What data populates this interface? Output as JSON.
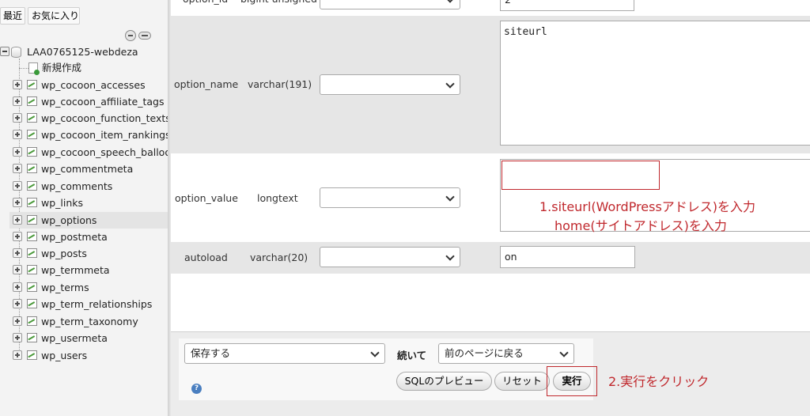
{
  "nav": {
    "tabs": {
      "recent": "最近",
      "favorites": "お気に入り"
    },
    "database": "LAA0765125-webdeza",
    "new_item": "新規作成",
    "tables": [
      "wp_cocoon_accesses",
      "wp_cocoon_affiliate_tags",
      "wp_cocoon_function_texts",
      "wp_cocoon_item_rankings",
      "wp_cocoon_speech_balloons",
      "wp_commentmeta",
      "wp_comments",
      "wp_links",
      "wp_options",
      "wp_postmeta",
      "wp_posts",
      "wp_termmeta",
      "wp_terms",
      "wp_term_relationships",
      "wp_term_taxonomy",
      "wp_usermeta",
      "wp_users"
    ],
    "active_table": "wp_options"
  },
  "form": {
    "rows": [
      {
        "name": "option_id",
        "type": "bigint unsigned",
        "value": "2"
      },
      {
        "name": "option_name",
        "type": "varchar(191)",
        "value": "siteurl"
      },
      {
        "name": "option_value",
        "type": "longtext",
        "value": ""
      },
      {
        "name": "autoload",
        "type": "varchar(20)",
        "value": "on"
      }
    ]
  },
  "annotations": {
    "step1_line1": "1.siteurl(WordPressアドレス)を入力",
    "step1_line2": "home(サイトアドレス)を入力",
    "step2": "2.実行をクリック",
    "color": "#c0282d"
  },
  "actions": {
    "save_select": "保存する",
    "continue_label": "続いて",
    "after_select": "前のページに戻る",
    "sql_preview": "SQLのプレビュー",
    "reset": "リセット",
    "execute": "実行",
    "help_icon": "?"
  }
}
